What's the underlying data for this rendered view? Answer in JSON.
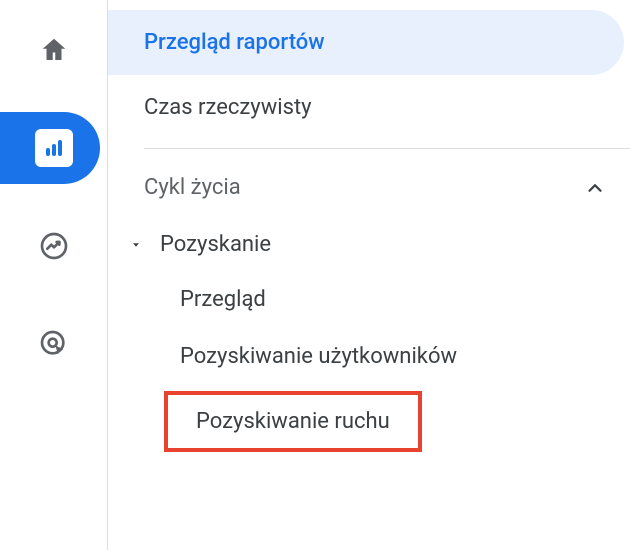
{
  "rail_icons": {
    "home": "home-icon",
    "reports": "bar-chart-icon",
    "explore": "trend-circle-icon",
    "advertising": "target-click-icon"
  },
  "nav": {
    "overview_label": "Przegląd raportów",
    "realtime_label": "Czas rzeczywisty"
  },
  "section": {
    "lifecycle_label": "Cykl życia",
    "acquisition_label": "Pozyskanie",
    "items": {
      "overview": "Przegląd",
      "user_acquisition": "Pozyskiwanie użytkowników",
      "traffic_acquisition": "Pozyskiwanie ruchu"
    }
  }
}
